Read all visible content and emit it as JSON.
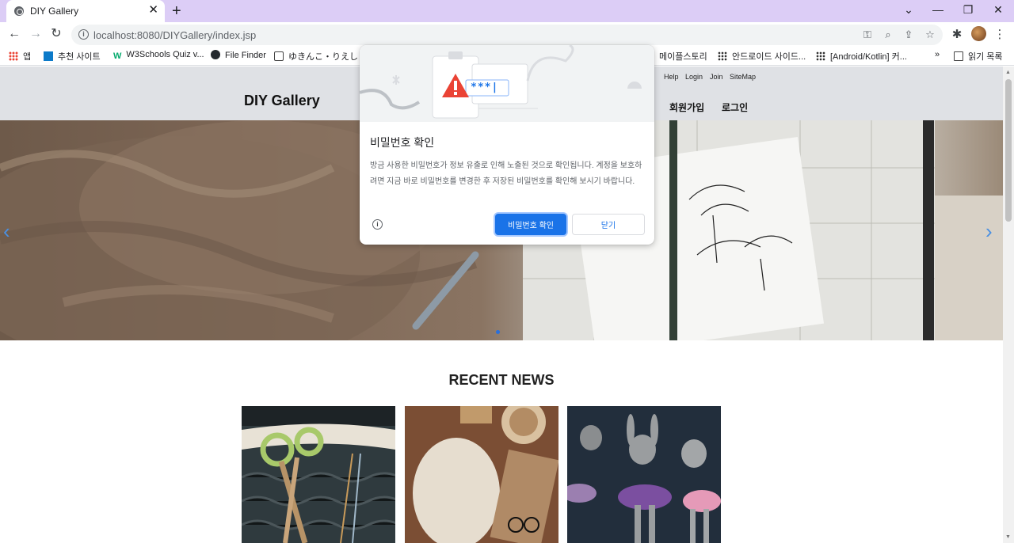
{
  "browser": {
    "tab": {
      "title": "DIY Gallery"
    },
    "url": "localhost:8080/DIYGallery/index.jsp",
    "bookmarks": [
      {
        "label": "앱"
      },
      {
        "label": "추천 사이트"
      },
      {
        "label": "W3Schools Quiz v..."
      },
      {
        "label": "File Finder"
      },
      {
        "label": "ゆきんこ・りえしょんの..."
      },
      {
        "label": "메이플스토리"
      },
      {
        "label": "안드로이드 사이드..."
      },
      {
        "label": "[Android/Kotlin] 커..."
      }
    ],
    "bookmarks_overflow": "»",
    "reading_list": "읽기 목록"
  },
  "site": {
    "util_links": [
      "Help",
      "Login",
      "Join",
      "SiteMap"
    ],
    "logo": "DIY Gallery",
    "nav": [
      "회원가입",
      "로그인"
    ],
    "section_title": "RECENT NEWS"
  },
  "dialog": {
    "title": "비밀번호 확인",
    "body": "방금 사용한 비밀번호가 정보 유출로 인해 노출된 것으로 확인됩니다. 계정을 보호하려면 지금 바로 비밀번호를 변경한 후 저장된 비밀번호를 확인해 보시기 바랍니다.",
    "password_mask": "***|",
    "primary_button": "비밀번호 확인",
    "secondary_button": "닫기"
  }
}
